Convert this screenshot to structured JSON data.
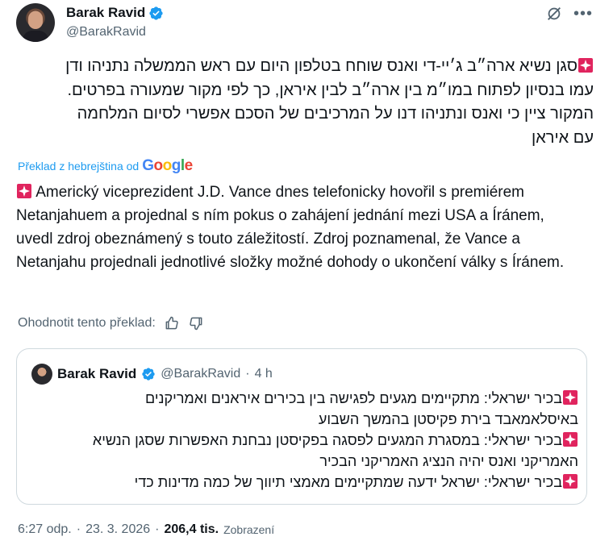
{
  "author": {
    "display_name": "Barak Ravid",
    "handle": "@BarakRavid"
  },
  "post": {
    "hebrew_lines": [
      "סגן נשיא ארה״ב ג׳יי-די ואנס שוחח בטלפון היום עם ראש הממשלה נתניהו ודן",
      "עמו בנסיון לפתוח במו״מ בין ארה״ב לבין איראן, כך לפי מקור שמעורה בפרטים.",
      "המקור ציין כי ואנס ונתניהו דנו על המרכיבים של הסכם אפשרי לסיום המלחמה",
      "עם איראן"
    ],
    "translate_label": "Překlad z hebrejština od",
    "translation_provider": "Google",
    "czech_translation": "Americký viceprezident J.D. Vance dnes telefonicky hovořil s premiérem Netanjahuem a projednal s ním pokus o zahájení jednání mezi USA a Íránem, uvedl zdroj obeznámený s touto záležitostí. Zdroj poznamenal, že Vance a Netanjahu projednali jednotlivé složky možné dohody o ukončení války s Íránem.",
    "rate_label": "Ohodnotit tento překlad:"
  },
  "quoted_post": {
    "display_name": "Barak Ravid",
    "handle": "@BarakRavid",
    "separator": "·",
    "time": "4 h",
    "lines": [
      "בכיר ישראלי: מתקיימים מגעים לפגישה בין בכירים איראנים ואמריקנים",
      "באיסלאמאבד בירת פקיסטן בהמשך השבוע",
      "בכיר ישראלי: במסגרת המגעים לפסגה בפקיסטן נבחנת האפשרות שסגן הנשיא",
      "האמריקני ואנס יהיה הנציג האמריקני הבכיר",
      "בכיר ישראלי: ישראל ידעה שמתקיימים מאמצי תיווך של כמה מדינות כדי"
    ],
    "siren_lines": [
      0,
      2,
      4
    ]
  },
  "meta": {
    "time": "6:27 odp.",
    "separator": "·",
    "date": "23. 3. 2026",
    "views_count": "206,4 tis.",
    "views_label": "Zobrazení"
  },
  "colors": {
    "accent": "#1d9bf0",
    "secondary_text": "#536471",
    "border": "#cfd9de",
    "siren_red": "#e0245e"
  },
  "icons": [
    "verified-badge-icon",
    "grok-icon",
    "more-icon",
    "siren-icon",
    "thumbs-up-icon",
    "thumbs-down-icon"
  ]
}
